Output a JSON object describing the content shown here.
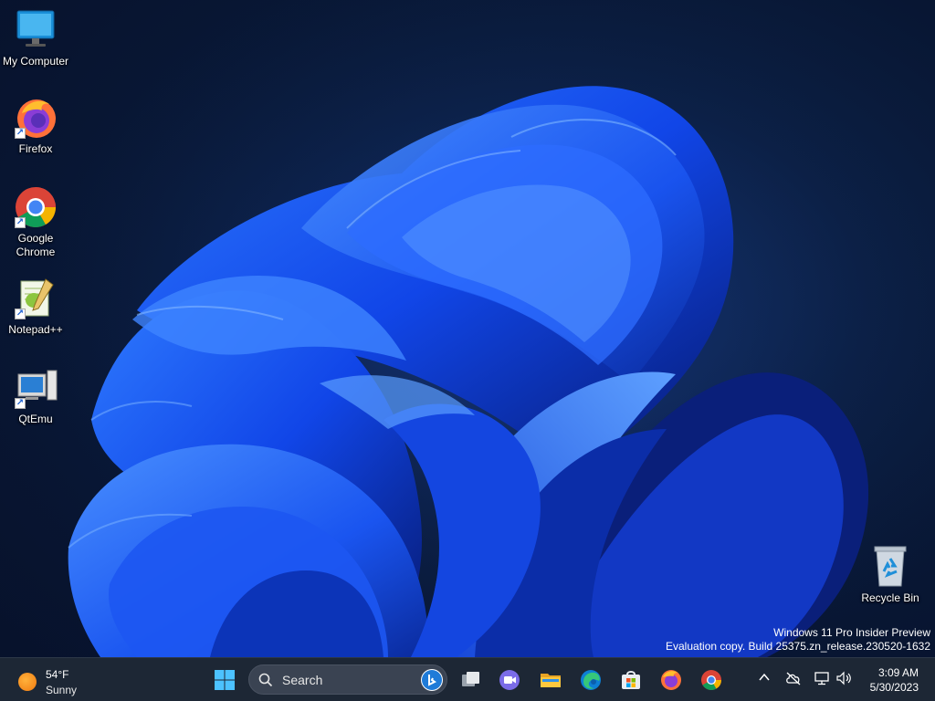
{
  "desktop": {
    "icons": [
      {
        "label": "My Computer",
        "name": "my-computer"
      },
      {
        "label": "Firefox",
        "name": "firefox"
      },
      {
        "label": "Google Chrome",
        "name": "google-chrome"
      },
      {
        "label": "Notepad++",
        "name": "notepad-plus-plus"
      },
      {
        "label": "QtEmu",
        "name": "qtemu"
      },
      {
        "label": "Recycle Bin",
        "name": "recycle-bin"
      }
    ],
    "watermark": {
      "line1": "Windows 11 Pro Insider Preview",
      "line2": "Evaluation copy. Build 25375.zn_release.230520-1632"
    }
  },
  "taskbar": {
    "weather": {
      "temperature": "54°F",
      "condition": "Sunny",
      "icon": "sun-icon"
    },
    "search": {
      "placeholder": "Search"
    },
    "pinned": [
      {
        "name": "start",
        "icon": "windows-logo-icon"
      },
      {
        "name": "task-view",
        "icon": "task-view-icon"
      },
      {
        "name": "teams-chat",
        "icon": "video-chat-icon"
      },
      {
        "name": "file-explorer",
        "icon": "folder-icon"
      },
      {
        "name": "edge",
        "icon": "edge-icon"
      },
      {
        "name": "microsoft-store",
        "icon": "store-icon"
      },
      {
        "name": "firefox",
        "icon": "firefox-icon"
      },
      {
        "name": "chrome",
        "icon": "chrome-icon"
      }
    ],
    "tray": {
      "icons": [
        "chevron-up-icon",
        "cloud-offline-icon",
        "network-icon",
        "volume-icon"
      ],
      "time": "3:09 AM",
      "date": "5/30/2023"
    }
  },
  "colors": {
    "accent": "#1a5cff",
    "taskbar": "#1d2735",
    "background": "#081633"
  }
}
